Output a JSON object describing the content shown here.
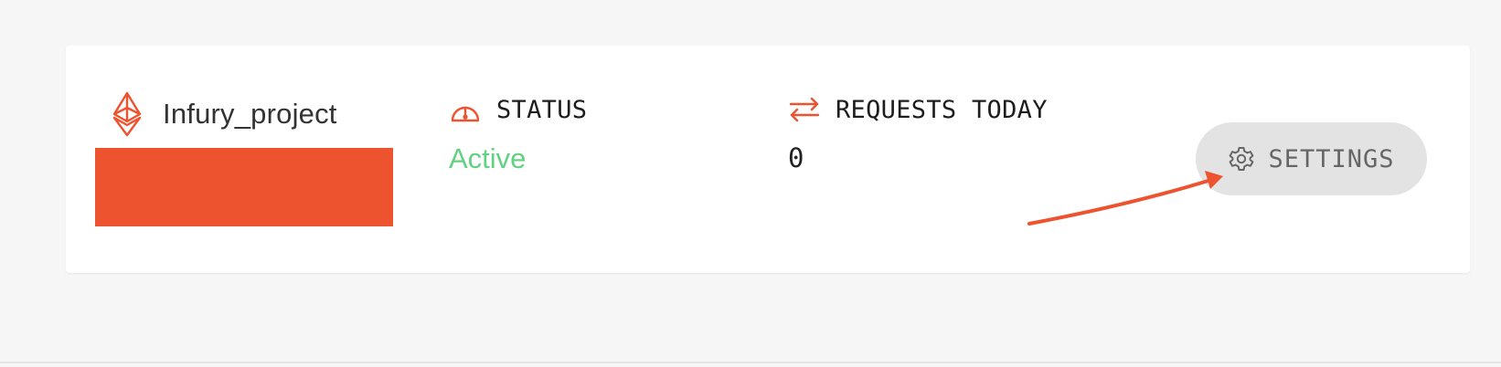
{
  "project": {
    "icon": "ethereum-icon",
    "name": "Infury_project"
  },
  "status": {
    "icon": "speedometer-icon",
    "label": "STATUS",
    "value": "Active"
  },
  "requests": {
    "icon": "swap-arrows-icon",
    "label": "REQUESTS TODAY",
    "value": "0"
  },
  "settings": {
    "icon": "gear-icon",
    "label": "SETTINGS"
  },
  "colors": {
    "accent": "#ee532f",
    "active": "#62d181",
    "button_bg": "#e3e3e3"
  }
}
